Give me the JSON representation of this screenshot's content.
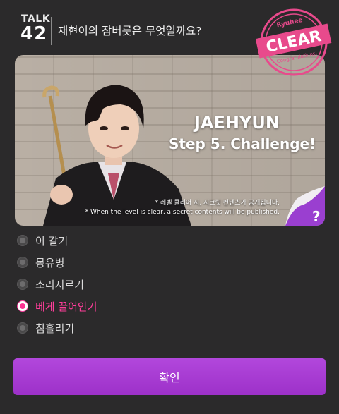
{
  "header": {
    "talk_label": "TALK",
    "talk_number": "42",
    "question": "재현이의 잠버릇은 무엇일까요?"
  },
  "stamp": {
    "top_text": "Ryuhee",
    "main_text": "CLEAR",
    "sub_text": "Congratulations!"
  },
  "banner": {
    "title": "JAEHYUN",
    "subtitle": "Step 5. Challenge!",
    "note_ko": "* 레벨 클리어 시, 시크릿 컨텐츠가 공개됩니다.",
    "note_en": "* When the level is clear, a secret contents will be published.",
    "hint_symbol": "?"
  },
  "options": [
    {
      "label": "이 갈기",
      "selected": false
    },
    {
      "label": "몽유병",
      "selected": false
    },
    {
      "label": "소리지르기",
      "selected": false
    },
    {
      "label": "베게 끌어안기",
      "selected": true
    },
    {
      "label": "침흘리기",
      "selected": false
    }
  ],
  "confirm_label": "확인",
  "colors": {
    "background": "#2b2a2b",
    "accent_pink": "#ff2f93",
    "button_purple": "#a83ad4"
  }
}
